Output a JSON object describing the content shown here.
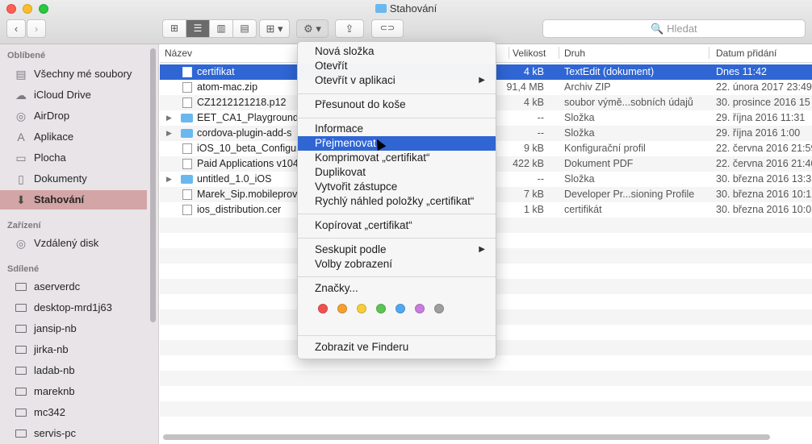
{
  "window": {
    "title": "Stahování"
  },
  "toolbar": {
    "back": "‹",
    "forward": "›",
    "view_icons": "⊞",
    "view_list": "☰",
    "view_columns": "▥",
    "view_coverflow": "▤",
    "arrange": "⊞ ▾",
    "action": "⚙ ▾",
    "share": "⇪",
    "tag": "⊂⊃",
    "search_placeholder": "🔍 Hledat"
  },
  "sidebar": {
    "favorites_header": "Oblíbené",
    "favorites": [
      {
        "label": "Všechny mé soubory",
        "icon": "all-files-icon",
        "glyph": "▤"
      },
      {
        "label": "iCloud Drive",
        "icon": "cloud-icon",
        "glyph": "☁"
      },
      {
        "label": "AirDrop",
        "icon": "airdrop-icon",
        "glyph": "◎"
      },
      {
        "label": "Aplikace",
        "icon": "applications-icon",
        "glyph": "A"
      },
      {
        "label": "Plocha",
        "icon": "desktop-icon",
        "glyph": "▭"
      },
      {
        "label": "Dokumenty",
        "icon": "documents-icon",
        "glyph": "▯"
      },
      {
        "label": "Stahování",
        "icon": "downloads-icon",
        "glyph": "⬇"
      }
    ],
    "devices_header": "Zařízení",
    "devices": [
      {
        "label": "Vzdálený disk",
        "icon": "remote-disc-icon",
        "glyph": "◎"
      }
    ],
    "shared_header": "Sdílené",
    "shared": [
      {
        "label": "aserverdc",
        "icon": "computer-icon"
      },
      {
        "label": "desktop-mrd1j63",
        "icon": "computer-icon"
      },
      {
        "label": "jansip-nb",
        "icon": "computer-icon"
      },
      {
        "label": "jirka-nb",
        "icon": "computer-icon"
      },
      {
        "label": "ladab-nb",
        "icon": "computer-icon"
      },
      {
        "label": "mareknb",
        "icon": "computer-icon"
      },
      {
        "label": "mc342",
        "icon": "computer-icon"
      },
      {
        "label": "servis-pc",
        "icon": "computer-icon"
      }
    ]
  },
  "columns": {
    "name": "Název",
    "size": "Velikost",
    "kind": "Druh",
    "date": "Datum přidání"
  },
  "files": [
    {
      "name": "certifikat",
      "size": "4 kB",
      "kind": "TextEdit (dokument)",
      "date": "Dnes 11:42",
      "type": "doc"
    },
    {
      "name": "atom-mac.zip",
      "size": "91,4 MB",
      "kind": "Archiv ZIP",
      "date": "22. února 2017 23:49",
      "type": "doc"
    },
    {
      "name": "CZ1212121218.p12",
      "size": "4 kB",
      "kind": "soubor výmě...sobních údajů",
      "date": "30. prosince 2016 15",
      "type": "doc"
    },
    {
      "name": "EET_CA1_Playground_v",
      "size": "--",
      "kind": "Složka",
      "date": "29. října 2016 11:31",
      "type": "folder"
    },
    {
      "name": "cordova-plugin-add-s",
      "size": "--",
      "kind": "Složka",
      "date": "29. října 2016 1:00",
      "type": "folder"
    },
    {
      "name": "iOS_10_beta_Configura",
      "size": "9 kB",
      "kind": "Konfigurační profil",
      "date": "22. června 2016 21:59",
      "type": "doc"
    },
    {
      "name": "Paid Applications v104",
      "size": "422 kB",
      "kind": "Dokument PDF",
      "date": "22. června 2016 21:40",
      "type": "doc"
    },
    {
      "name": "untitled_1.0_iOS",
      "size": "--",
      "kind": "Složka",
      "date": "30. března 2016 13:3",
      "type": "folder"
    },
    {
      "name": "Marek_Sip.mobileprov",
      "size": "7 kB",
      "kind": "Developer Pr...sioning Profile",
      "date": "30. března 2016 10:1",
      "type": "doc"
    },
    {
      "name": "ios_distribution.cer",
      "size": "1 kB",
      "kind": "certifikát",
      "date": "30. března 2016 10:0",
      "type": "doc"
    }
  ],
  "menu": {
    "new_folder": "Nová složka",
    "open": "Otevřít",
    "open_with": "Otevřít v aplikaci",
    "move_to_trash": "Přesunout do koše",
    "get_info": "Informace",
    "rename": "Přejmenovat",
    "compress": "Komprimovat „certifikat“",
    "duplicate": "Duplikovat",
    "make_alias": "Vytvořit zástupce",
    "quick_look": "Rychlý náhled položky „certifikat“",
    "copy": "Kopírovat „certifikat“",
    "group_by": "Seskupit podle",
    "view_options": "Volby zobrazení",
    "tags": "Značky...",
    "show_in_finder": "Zobrazit ve Finderu",
    "submenu_arrow": "▶",
    "tag_colors": [
      "#f0514f",
      "#f5a033",
      "#f6cd3c",
      "#5cc454",
      "#51a8f0",
      "#c77ddb",
      "#9e9e9e"
    ]
  },
  "selected_sidebar_index": 6
}
